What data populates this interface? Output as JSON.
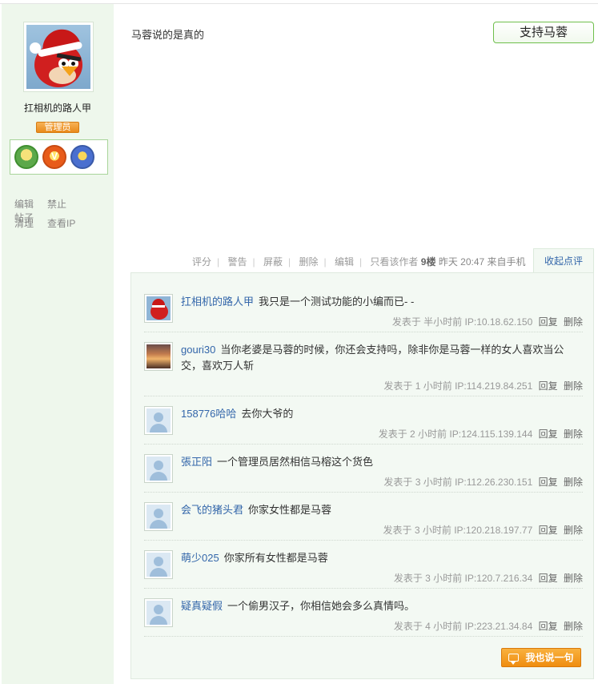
{
  "author": {
    "name": "扛相机的路人甲",
    "role": "管理员",
    "avatar_icon": "angry-bird-santa-avatar",
    "medals": [
      "user-medal-icon",
      "v-medal-icon",
      "shield-medal-icon"
    ]
  },
  "admin_links": {
    "edit": "编辑",
    "ban": "禁止",
    "posts": "帖子",
    "clear": "清理",
    "view_ip": "查看IP"
  },
  "post": {
    "text": "马蓉说的是真的",
    "support_button": "支持马蓉"
  },
  "actions": {
    "rate": "评分",
    "warn": "警告",
    "block": "屏蔽",
    "delete": "删除",
    "edit": "编辑",
    "author_only": "只看该作者",
    "floor": "9楼",
    "time": "昨天 20:47",
    "source": "来自手机",
    "collapse": "收起点评"
  },
  "comments": [
    {
      "user": "扛相机的路人甲",
      "text": "我只是一个测试功能的小编而已- -",
      "posted_prefix": "发表于",
      "time": "半小时前",
      "ip": "IP:10.18.62.150",
      "reply": "回复",
      "delete": "删除",
      "avatar": "bird"
    },
    {
      "user": "gouri30",
      "text": "当你老婆是马蓉的时候，你还会支持吗，除非你是马蓉一样的女人喜欢当公交，喜欢万人斩",
      "posted_prefix": "发表于",
      "time": "1 小时前",
      "ip": "IP:114.219.84.251",
      "reply": "回复",
      "delete": "删除",
      "avatar": "sunset"
    },
    {
      "user": "158776哈哈",
      "text": "去你大爷的",
      "posted_prefix": "发表于",
      "time": "2 小时前",
      "ip": "IP:124.115.139.144",
      "reply": "回复",
      "delete": "删除",
      "avatar": "default"
    },
    {
      "user": "張正阳",
      "text": "一个管理员居然相信马榕这个货色",
      "posted_prefix": "发表于",
      "time": "3 小时前",
      "ip": "IP:112.26.230.151",
      "reply": "回复",
      "delete": "删除",
      "avatar": "default"
    },
    {
      "user": "会飞的猪头君",
      "text": "你家女性都是马蓉",
      "posted_prefix": "发表于",
      "time": "3 小时前",
      "ip": "IP:120.218.197.77",
      "reply": "回复",
      "delete": "删除",
      "avatar": "default"
    },
    {
      "user": "萌少025",
      "text": "你家所有女性都是马蓉",
      "posted_prefix": "发表于",
      "time": "3 小时前",
      "ip": "IP:120.7.216.34",
      "reply": "回复",
      "delete": "删除",
      "avatar": "default"
    },
    {
      "user": "疑真疑假",
      "text": "一个偷男汉子，你相信她会多么真情吗。",
      "posted_prefix": "发表于",
      "time": "4 小时前",
      "ip": "IP:223.21.34.84",
      "reply": "回复",
      "delete": "删除",
      "avatar": "default"
    }
  ],
  "say_button": "我也说一句",
  "colors": {
    "sidebar_bg": "#eef7ec",
    "link_blue": "#3366aa",
    "accent_orange": "#ef8d10",
    "support_border": "#6fbf4c"
  }
}
